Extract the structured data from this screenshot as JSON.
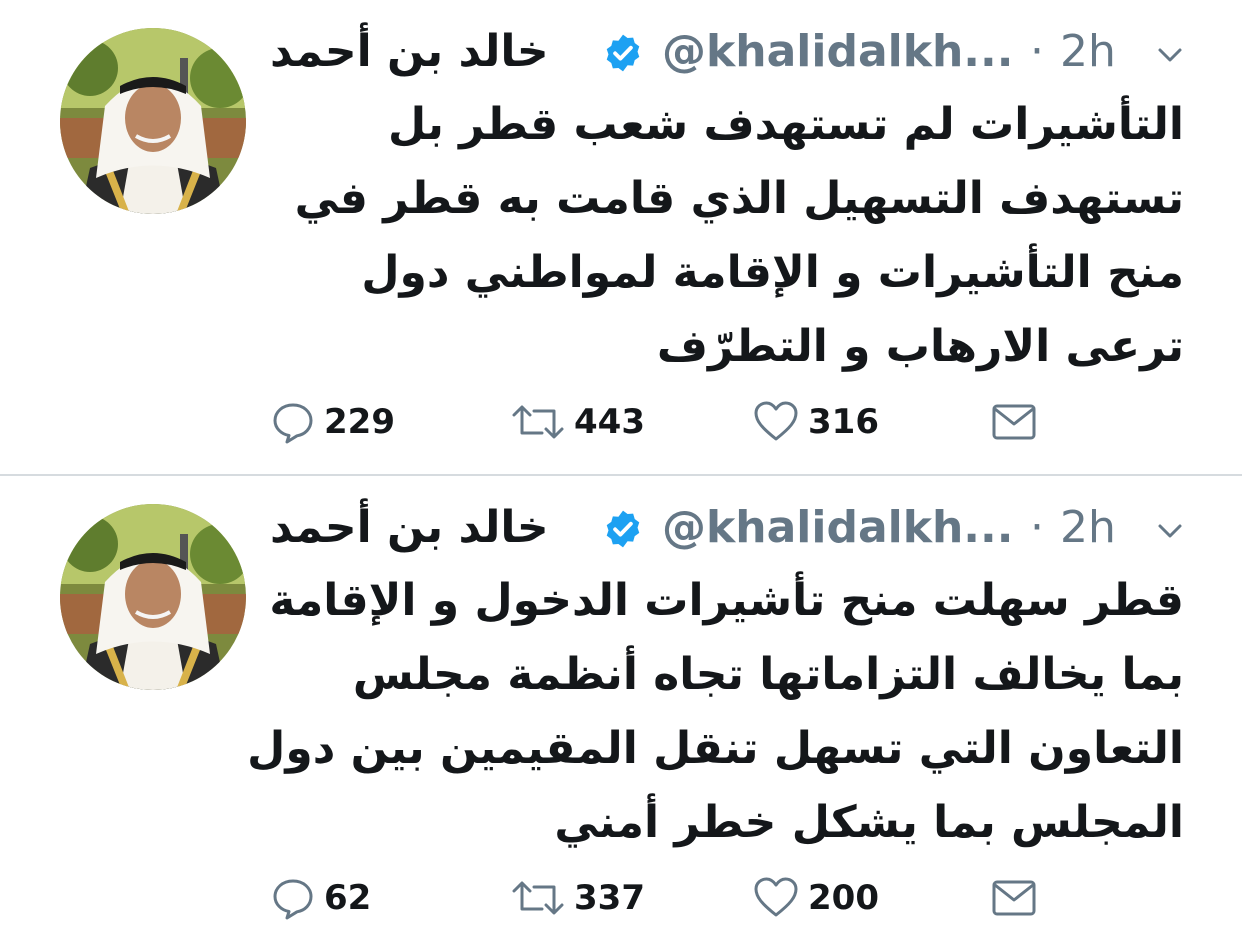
{
  "tweets": [
    {
      "author_name": "خالد بن أحمد",
      "handle": "@khalidalkh...",
      "separator": "·",
      "time": "2h",
      "body_lines": [
        "التأشيرات لم تستهدف شعب قطر بل",
        "تستهدف التسهيل الذي قامت به قطر في",
        "منح التأشيرات و الإقامة لمواطني دول",
        "ترعى الارهاب  و التطرّف"
      ],
      "replies": "229",
      "retweets": "443",
      "likes": "316"
    },
    {
      "author_name": "خالد بن أحمد",
      "handle": "@khalidalkh...",
      "separator": "·",
      "time": "2h",
      "body_lines": [
        "قطر سهلت منح تأشيرات الدخول و الإقامة",
        "بما يخالف التزاماتها تجاه أنظمة مجلس",
        "التعاون التي تسهل تنقل المقيمين بين دول",
        "المجلس بما يشكل خطر أمني"
      ],
      "replies": "62",
      "retweets": "337",
      "likes": "200"
    }
  ],
  "icons": {
    "verified": "verified-badge-icon",
    "caret": "chevron-down-icon",
    "reply": "reply-icon",
    "retweet": "retweet-icon",
    "like": "heart-icon",
    "message": "envelope-icon"
  },
  "colors": {
    "verified_blue": "#1da1f2",
    "text_primary": "#14171a",
    "text_secondary": "#657786",
    "divider": "#d6dbdf"
  }
}
